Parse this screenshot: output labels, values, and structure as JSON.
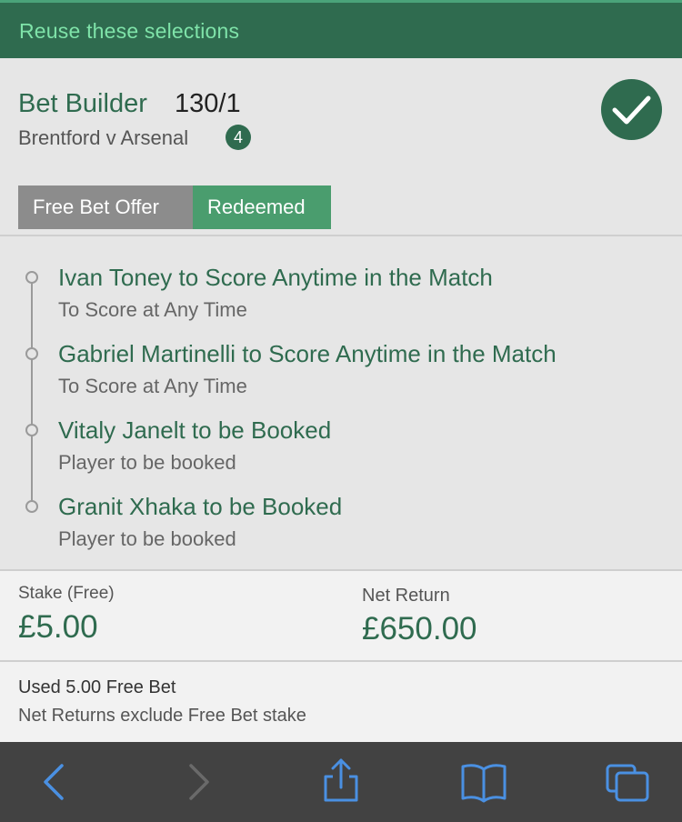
{
  "banner": {
    "reuse_label": "Reuse these selections"
  },
  "bet": {
    "title": "Bet Builder",
    "odds": "130/1",
    "match": "Brentford v Arsenal",
    "selection_count": "4"
  },
  "offer": {
    "label": "Free Bet Offer",
    "status": "Redeemed"
  },
  "selections": [
    {
      "title": "Ivan Toney to Score Anytime in the Match",
      "market": "To Score at Any Time"
    },
    {
      "title": "Gabriel Martinelli to Score Anytime in the Match",
      "market": "To Score at Any Time"
    },
    {
      "title": "Vitaly Janelt to be Booked",
      "market": "Player to be booked"
    },
    {
      "title": "Granit Xhaka to be Booked",
      "market": "Player to be booked"
    }
  ],
  "stake": {
    "label": "Stake (Free)",
    "value": "£5.00"
  },
  "net_return": {
    "label": "Net Return",
    "value": "£650.00"
  },
  "info": {
    "used": "Used 5.00 Free Bet",
    "note": "Net Returns exclude Free Bet stake"
  },
  "toolbar": {
    "icons": [
      "back-icon",
      "forward-icon",
      "share-icon",
      "bookmarks-icon",
      "tabs-icon"
    ]
  },
  "colors": {
    "brand_dark": "#2f6b4f",
    "brand_light": "#4a9d6e",
    "toolbar_accent": "#4a90e2"
  }
}
